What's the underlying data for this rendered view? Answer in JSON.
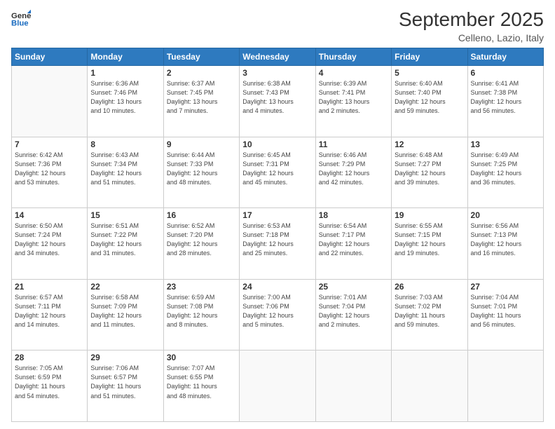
{
  "logo": {
    "line1": "General",
    "line2": "Blue"
  },
  "title": "September 2025",
  "location": "Celleno, Lazio, Italy",
  "days_of_week": [
    "Sunday",
    "Monday",
    "Tuesday",
    "Wednesday",
    "Thursday",
    "Friday",
    "Saturday"
  ],
  "weeks": [
    [
      {
        "num": "",
        "info": ""
      },
      {
        "num": "1",
        "info": "Sunrise: 6:36 AM\nSunset: 7:46 PM\nDaylight: 13 hours\nand 10 minutes."
      },
      {
        "num": "2",
        "info": "Sunrise: 6:37 AM\nSunset: 7:45 PM\nDaylight: 13 hours\nand 7 minutes."
      },
      {
        "num": "3",
        "info": "Sunrise: 6:38 AM\nSunset: 7:43 PM\nDaylight: 13 hours\nand 4 minutes."
      },
      {
        "num": "4",
        "info": "Sunrise: 6:39 AM\nSunset: 7:41 PM\nDaylight: 13 hours\nand 2 minutes."
      },
      {
        "num": "5",
        "info": "Sunrise: 6:40 AM\nSunset: 7:40 PM\nDaylight: 12 hours\nand 59 minutes."
      },
      {
        "num": "6",
        "info": "Sunrise: 6:41 AM\nSunset: 7:38 PM\nDaylight: 12 hours\nand 56 minutes."
      }
    ],
    [
      {
        "num": "7",
        "info": "Sunrise: 6:42 AM\nSunset: 7:36 PM\nDaylight: 12 hours\nand 53 minutes."
      },
      {
        "num": "8",
        "info": "Sunrise: 6:43 AM\nSunset: 7:34 PM\nDaylight: 12 hours\nand 51 minutes."
      },
      {
        "num": "9",
        "info": "Sunrise: 6:44 AM\nSunset: 7:33 PM\nDaylight: 12 hours\nand 48 minutes."
      },
      {
        "num": "10",
        "info": "Sunrise: 6:45 AM\nSunset: 7:31 PM\nDaylight: 12 hours\nand 45 minutes."
      },
      {
        "num": "11",
        "info": "Sunrise: 6:46 AM\nSunset: 7:29 PM\nDaylight: 12 hours\nand 42 minutes."
      },
      {
        "num": "12",
        "info": "Sunrise: 6:48 AM\nSunset: 7:27 PM\nDaylight: 12 hours\nand 39 minutes."
      },
      {
        "num": "13",
        "info": "Sunrise: 6:49 AM\nSunset: 7:25 PM\nDaylight: 12 hours\nand 36 minutes."
      }
    ],
    [
      {
        "num": "14",
        "info": "Sunrise: 6:50 AM\nSunset: 7:24 PM\nDaylight: 12 hours\nand 34 minutes."
      },
      {
        "num": "15",
        "info": "Sunrise: 6:51 AM\nSunset: 7:22 PM\nDaylight: 12 hours\nand 31 minutes."
      },
      {
        "num": "16",
        "info": "Sunrise: 6:52 AM\nSunset: 7:20 PM\nDaylight: 12 hours\nand 28 minutes."
      },
      {
        "num": "17",
        "info": "Sunrise: 6:53 AM\nSunset: 7:18 PM\nDaylight: 12 hours\nand 25 minutes."
      },
      {
        "num": "18",
        "info": "Sunrise: 6:54 AM\nSunset: 7:17 PM\nDaylight: 12 hours\nand 22 minutes."
      },
      {
        "num": "19",
        "info": "Sunrise: 6:55 AM\nSunset: 7:15 PM\nDaylight: 12 hours\nand 19 minutes."
      },
      {
        "num": "20",
        "info": "Sunrise: 6:56 AM\nSunset: 7:13 PM\nDaylight: 12 hours\nand 16 minutes."
      }
    ],
    [
      {
        "num": "21",
        "info": "Sunrise: 6:57 AM\nSunset: 7:11 PM\nDaylight: 12 hours\nand 14 minutes."
      },
      {
        "num": "22",
        "info": "Sunrise: 6:58 AM\nSunset: 7:09 PM\nDaylight: 12 hours\nand 11 minutes."
      },
      {
        "num": "23",
        "info": "Sunrise: 6:59 AM\nSunset: 7:08 PM\nDaylight: 12 hours\nand 8 minutes."
      },
      {
        "num": "24",
        "info": "Sunrise: 7:00 AM\nSunset: 7:06 PM\nDaylight: 12 hours\nand 5 minutes."
      },
      {
        "num": "25",
        "info": "Sunrise: 7:01 AM\nSunset: 7:04 PM\nDaylight: 12 hours\nand 2 minutes."
      },
      {
        "num": "26",
        "info": "Sunrise: 7:03 AM\nSunset: 7:02 PM\nDaylight: 11 hours\nand 59 minutes."
      },
      {
        "num": "27",
        "info": "Sunrise: 7:04 AM\nSunset: 7:01 PM\nDaylight: 11 hours\nand 56 minutes."
      }
    ],
    [
      {
        "num": "28",
        "info": "Sunrise: 7:05 AM\nSunset: 6:59 PM\nDaylight: 11 hours\nand 54 minutes."
      },
      {
        "num": "29",
        "info": "Sunrise: 7:06 AM\nSunset: 6:57 PM\nDaylight: 11 hours\nand 51 minutes."
      },
      {
        "num": "30",
        "info": "Sunrise: 7:07 AM\nSunset: 6:55 PM\nDaylight: 11 hours\nand 48 minutes."
      },
      {
        "num": "",
        "info": ""
      },
      {
        "num": "",
        "info": ""
      },
      {
        "num": "",
        "info": ""
      },
      {
        "num": "",
        "info": ""
      }
    ]
  ]
}
